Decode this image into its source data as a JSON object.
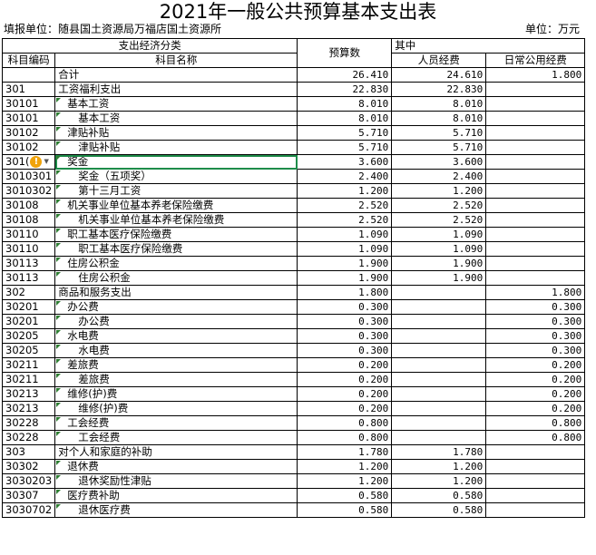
{
  "title": "2021年一般公共预算基本支出表",
  "unit_left": "填报单位：随县国土资源局万福店国土资源所",
  "unit_right": "单位：万元",
  "headers": {
    "group": "支出经济分类",
    "code": "科目编码",
    "name": "科目名称",
    "budget": "预算数",
    "of_which": "其中",
    "personnel": "人员经费",
    "daily": "日常公用经费"
  },
  "warning_icon": "warning-icon",
  "rows": [
    {
      "code": "",
      "name": "合计",
      "budget": "26.410",
      "personnel": "24.610",
      "daily": "1.800",
      "level": 0
    },
    {
      "code": "301",
      "name": "工资福利支出",
      "budget": "22.830",
      "personnel": "22.830",
      "daily": "",
      "level": 0
    },
    {
      "code": "30101",
      "name": "基本工资",
      "budget": "8.010",
      "personnel": "8.010",
      "daily": "",
      "level": 1
    },
    {
      "code": "30101",
      "name": "基本工资",
      "budget": "8.010",
      "personnel": "8.010",
      "daily": "",
      "level": 2
    },
    {
      "code": "30102",
      "name": "津贴补贴",
      "budget": "5.710",
      "personnel": "5.710",
      "daily": "",
      "level": 1
    },
    {
      "code": "30102",
      "name": "津贴补贴",
      "budget": "5.710",
      "personnel": "5.710",
      "daily": "",
      "level": 2
    },
    {
      "code": "301(",
      "name": "奖金",
      "budget": "3.600",
      "personnel": "3.600",
      "daily": "",
      "level": 1
    },
    {
      "code": "3010301",
      "name": "奖金（五项奖）",
      "budget": "2.400",
      "personnel": "2.400",
      "daily": "",
      "level": 2
    },
    {
      "code": "3010302",
      "name": "第十三月工资",
      "budget": "1.200",
      "personnel": "1.200",
      "daily": "",
      "level": 2
    },
    {
      "code": "30108",
      "name": "机关事业单位基本养老保险缴费",
      "budget": "2.520",
      "personnel": "2.520",
      "daily": "",
      "level": 1
    },
    {
      "code": "30108",
      "name": "机关事业单位基本养老保险缴费",
      "budget": "2.520",
      "personnel": "2.520",
      "daily": "",
      "level": 2
    },
    {
      "code": "30110",
      "name": "职工基本医疗保险缴费",
      "budget": "1.090",
      "personnel": "1.090",
      "daily": "",
      "level": 1
    },
    {
      "code": "30110",
      "name": "职工基本医疗保险缴费",
      "budget": "1.090",
      "personnel": "1.090",
      "daily": "",
      "level": 2
    },
    {
      "code": "30113",
      "name": "住房公积金",
      "budget": "1.900",
      "personnel": "1.900",
      "daily": "",
      "level": 1
    },
    {
      "code": "30113",
      "name": "住房公积金",
      "budget": "1.900",
      "personnel": "1.900",
      "daily": "",
      "level": 2
    },
    {
      "code": "302",
      "name": "商品和服务支出",
      "budget": "1.800",
      "personnel": "",
      "daily": "1.800",
      "level": 0
    },
    {
      "code": "30201",
      "name": "办公费",
      "budget": "0.300",
      "personnel": "",
      "daily": "0.300",
      "level": 1
    },
    {
      "code": "30201",
      "name": "办公费",
      "budget": "0.300",
      "personnel": "",
      "daily": "0.300",
      "level": 2
    },
    {
      "code": "30205",
      "name": "水电费",
      "budget": "0.300",
      "personnel": "",
      "daily": "0.300",
      "level": 1
    },
    {
      "code": "30205",
      "name": "水电费",
      "budget": "0.300",
      "personnel": "",
      "daily": "0.300",
      "level": 2
    },
    {
      "code": "30211",
      "name": "差旅费",
      "budget": "0.200",
      "personnel": "",
      "daily": "0.200",
      "level": 1
    },
    {
      "code": "30211",
      "name": "差旅费",
      "budget": "0.200",
      "personnel": "",
      "daily": "0.200",
      "level": 2
    },
    {
      "code": "30213",
      "name": "维修(护)费",
      "budget": "0.200",
      "personnel": "",
      "daily": "0.200",
      "level": 1
    },
    {
      "code": "30213",
      "name": "维修(护)费",
      "budget": "0.200",
      "personnel": "",
      "daily": "0.200",
      "level": 2
    },
    {
      "code": "30228",
      "name": "工会经费",
      "budget": "0.800",
      "personnel": "",
      "daily": "0.800",
      "level": 1
    },
    {
      "code": "30228",
      "name": "工会经费",
      "budget": "0.800",
      "personnel": "",
      "daily": "0.800",
      "level": 2
    },
    {
      "code": "303",
      "name": "对个人和家庭的补助",
      "budget": "1.780",
      "personnel": "1.780",
      "daily": "",
      "level": 0
    },
    {
      "code": "30302",
      "name": "退休费",
      "budget": "1.200",
      "personnel": "1.200",
      "daily": "",
      "level": 1
    },
    {
      "code": "3030203",
      "name": "退休奖励性津贴",
      "budget": "1.200",
      "personnel": "1.200",
      "daily": "",
      "level": 2
    },
    {
      "code": "30307",
      "name": "医疗费补助",
      "budget": "0.580",
      "personnel": "0.580",
      "daily": "",
      "level": 1
    },
    {
      "code": "3030702",
      "name": "退休医疗费",
      "budget": "0.580",
      "personnel": "0.580",
      "daily": "",
      "level": 2
    }
  ]
}
